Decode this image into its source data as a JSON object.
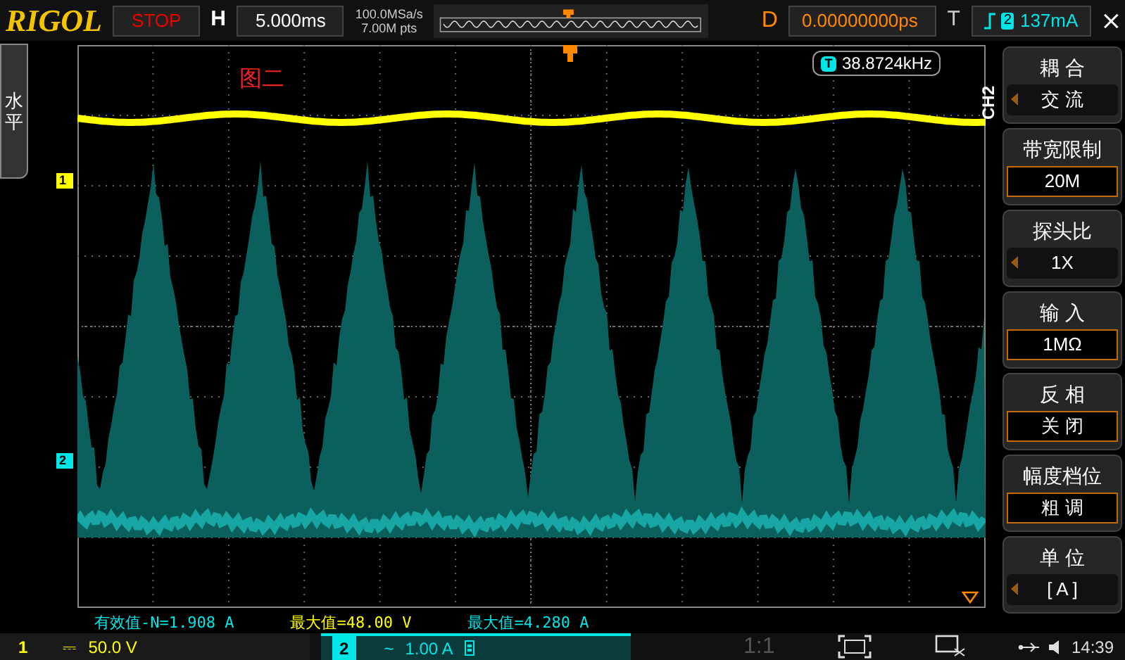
{
  "header": {
    "brand": "RIGOL",
    "run_state": "STOP",
    "timebase_label": "H",
    "timebase": "5.000ms",
    "sample_rate": "100.0MSa/s",
    "memory_depth": "7.00M pts",
    "delay_label": "D",
    "delay": "0.00000000ps",
    "trigger_label": "T",
    "trigger_source": "2",
    "trigger_level": "137mA"
  },
  "side_tab": {
    "label": "水平"
  },
  "screen": {
    "annotation": "图二",
    "frequency_badge": "T",
    "frequency": "38.8724kHz",
    "channel_markers": [
      {
        "label": "1",
        "color": "#ffff00"
      },
      {
        "label": "2",
        "color": "#00e5e5"
      }
    ]
  },
  "menu": {
    "title": "CH2",
    "items": [
      {
        "label": "耦 合",
        "value": "交 流",
        "kind": "cycle"
      },
      {
        "label": "带宽限制",
        "value": "20M",
        "kind": "box"
      },
      {
        "label": "探头比",
        "value": "1X",
        "kind": "cycle"
      },
      {
        "label": "输 入",
        "value": "1MΩ",
        "kind": "box"
      },
      {
        "label": "反 相",
        "value": "关 闭",
        "kind": "box"
      },
      {
        "label": "幅度档位",
        "value": "粗 调",
        "kind": "box"
      },
      {
        "label": "单 位",
        "value": "[ A ]",
        "kind": "cycle"
      }
    ]
  },
  "measurements": [
    {
      "text": "有效值-N=1.908 A",
      "color": "#00e5e5"
    },
    {
      "text": "最大值=48.00 V",
      "color": "#ffff00"
    },
    {
      "text": "最大值=4.280 A",
      "color": "#00e5e5"
    }
  ],
  "status_bar": {
    "channels": [
      {
        "number": "1",
        "coupling": "⎓",
        "scale": "50.0 V",
        "selected": false
      },
      {
        "number": "2",
        "coupling": "~",
        "scale": "1.00 A",
        "selected": true
      }
    ],
    "ratio": "1:1",
    "time": "14:39"
  }
}
